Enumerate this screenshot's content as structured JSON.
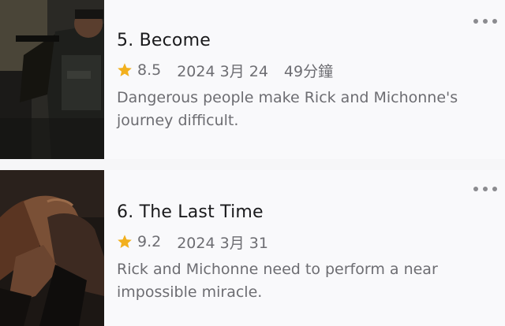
{
  "episodes": [
    {
      "title": "5. Become",
      "rating": "8.5",
      "date": "2024 3月 24",
      "duration": "49分鐘",
      "description": "Dangerous people make Rick and Michonne's journey difficult."
    },
    {
      "title": "6. The Last Time",
      "rating": "9.2",
      "date": "2024 3月 31",
      "duration": "",
      "description": "Rick and Michonne need to perform a near impossible miracle."
    }
  ],
  "icons": {
    "more": "more-horizontal-icon",
    "rating": "star-icon"
  },
  "colors": {
    "star": "#f2b01e",
    "title": "#1a1a1c",
    "meta": "#6d6d72",
    "card_background": "#f9f9fb"
  }
}
